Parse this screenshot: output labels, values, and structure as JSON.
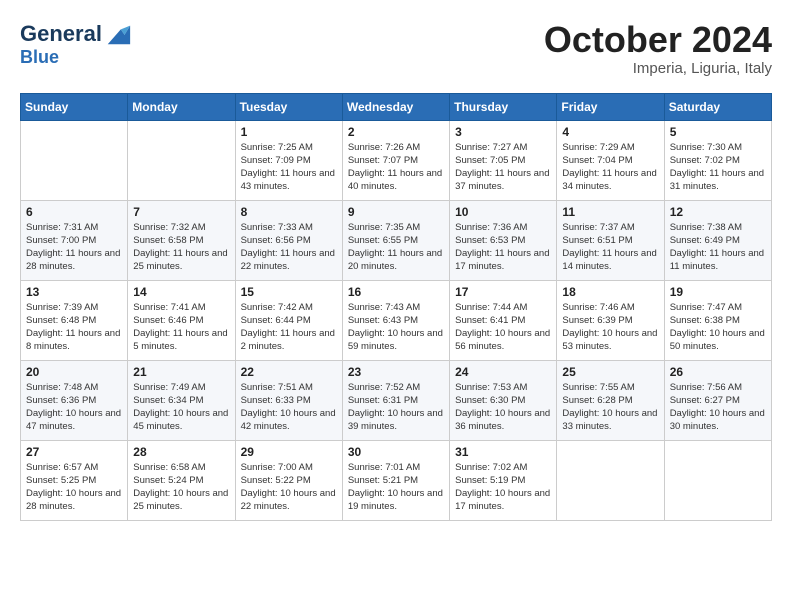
{
  "header": {
    "logo_line1": "General",
    "logo_line2": "Blue",
    "month": "October 2024",
    "location": "Imperia, Liguria, Italy"
  },
  "weekdays": [
    "Sunday",
    "Monday",
    "Tuesday",
    "Wednesday",
    "Thursday",
    "Friday",
    "Saturday"
  ],
  "weeks": [
    [
      {
        "day": "",
        "content": ""
      },
      {
        "day": "",
        "content": ""
      },
      {
        "day": "1",
        "content": "Sunrise: 7:25 AM\nSunset: 7:09 PM\nDaylight: 11 hours and 43 minutes."
      },
      {
        "day": "2",
        "content": "Sunrise: 7:26 AM\nSunset: 7:07 PM\nDaylight: 11 hours and 40 minutes."
      },
      {
        "day": "3",
        "content": "Sunrise: 7:27 AM\nSunset: 7:05 PM\nDaylight: 11 hours and 37 minutes."
      },
      {
        "day": "4",
        "content": "Sunrise: 7:29 AM\nSunset: 7:04 PM\nDaylight: 11 hours and 34 minutes."
      },
      {
        "day": "5",
        "content": "Sunrise: 7:30 AM\nSunset: 7:02 PM\nDaylight: 11 hours and 31 minutes."
      }
    ],
    [
      {
        "day": "6",
        "content": "Sunrise: 7:31 AM\nSunset: 7:00 PM\nDaylight: 11 hours and 28 minutes."
      },
      {
        "day": "7",
        "content": "Sunrise: 7:32 AM\nSunset: 6:58 PM\nDaylight: 11 hours and 25 minutes."
      },
      {
        "day": "8",
        "content": "Sunrise: 7:33 AM\nSunset: 6:56 PM\nDaylight: 11 hours and 22 minutes."
      },
      {
        "day": "9",
        "content": "Sunrise: 7:35 AM\nSunset: 6:55 PM\nDaylight: 11 hours and 20 minutes."
      },
      {
        "day": "10",
        "content": "Sunrise: 7:36 AM\nSunset: 6:53 PM\nDaylight: 11 hours and 17 minutes."
      },
      {
        "day": "11",
        "content": "Sunrise: 7:37 AM\nSunset: 6:51 PM\nDaylight: 11 hours and 14 minutes."
      },
      {
        "day": "12",
        "content": "Sunrise: 7:38 AM\nSunset: 6:49 PM\nDaylight: 11 hours and 11 minutes."
      }
    ],
    [
      {
        "day": "13",
        "content": "Sunrise: 7:39 AM\nSunset: 6:48 PM\nDaylight: 11 hours and 8 minutes."
      },
      {
        "day": "14",
        "content": "Sunrise: 7:41 AM\nSunset: 6:46 PM\nDaylight: 11 hours and 5 minutes."
      },
      {
        "day": "15",
        "content": "Sunrise: 7:42 AM\nSunset: 6:44 PM\nDaylight: 11 hours and 2 minutes."
      },
      {
        "day": "16",
        "content": "Sunrise: 7:43 AM\nSunset: 6:43 PM\nDaylight: 10 hours and 59 minutes."
      },
      {
        "day": "17",
        "content": "Sunrise: 7:44 AM\nSunset: 6:41 PM\nDaylight: 10 hours and 56 minutes."
      },
      {
        "day": "18",
        "content": "Sunrise: 7:46 AM\nSunset: 6:39 PM\nDaylight: 10 hours and 53 minutes."
      },
      {
        "day": "19",
        "content": "Sunrise: 7:47 AM\nSunset: 6:38 PM\nDaylight: 10 hours and 50 minutes."
      }
    ],
    [
      {
        "day": "20",
        "content": "Sunrise: 7:48 AM\nSunset: 6:36 PM\nDaylight: 10 hours and 47 minutes."
      },
      {
        "day": "21",
        "content": "Sunrise: 7:49 AM\nSunset: 6:34 PM\nDaylight: 10 hours and 45 minutes."
      },
      {
        "day": "22",
        "content": "Sunrise: 7:51 AM\nSunset: 6:33 PM\nDaylight: 10 hours and 42 minutes."
      },
      {
        "day": "23",
        "content": "Sunrise: 7:52 AM\nSunset: 6:31 PM\nDaylight: 10 hours and 39 minutes."
      },
      {
        "day": "24",
        "content": "Sunrise: 7:53 AM\nSunset: 6:30 PM\nDaylight: 10 hours and 36 minutes."
      },
      {
        "day": "25",
        "content": "Sunrise: 7:55 AM\nSunset: 6:28 PM\nDaylight: 10 hours and 33 minutes."
      },
      {
        "day": "26",
        "content": "Sunrise: 7:56 AM\nSunset: 6:27 PM\nDaylight: 10 hours and 30 minutes."
      }
    ],
    [
      {
        "day": "27",
        "content": "Sunrise: 6:57 AM\nSunset: 5:25 PM\nDaylight: 10 hours and 28 minutes."
      },
      {
        "day": "28",
        "content": "Sunrise: 6:58 AM\nSunset: 5:24 PM\nDaylight: 10 hours and 25 minutes."
      },
      {
        "day": "29",
        "content": "Sunrise: 7:00 AM\nSunset: 5:22 PM\nDaylight: 10 hours and 22 minutes."
      },
      {
        "day": "30",
        "content": "Sunrise: 7:01 AM\nSunset: 5:21 PM\nDaylight: 10 hours and 19 minutes."
      },
      {
        "day": "31",
        "content": "Sunrise: 7:02 AM\nSunset: 5:19 PM\nDaylight: 10 hours and 17 minutes."
      },
      {
        "day": "",
        "content": ""
      },
      {
        "day": "",
        "content": ""
      }
    ]
  ]
}
